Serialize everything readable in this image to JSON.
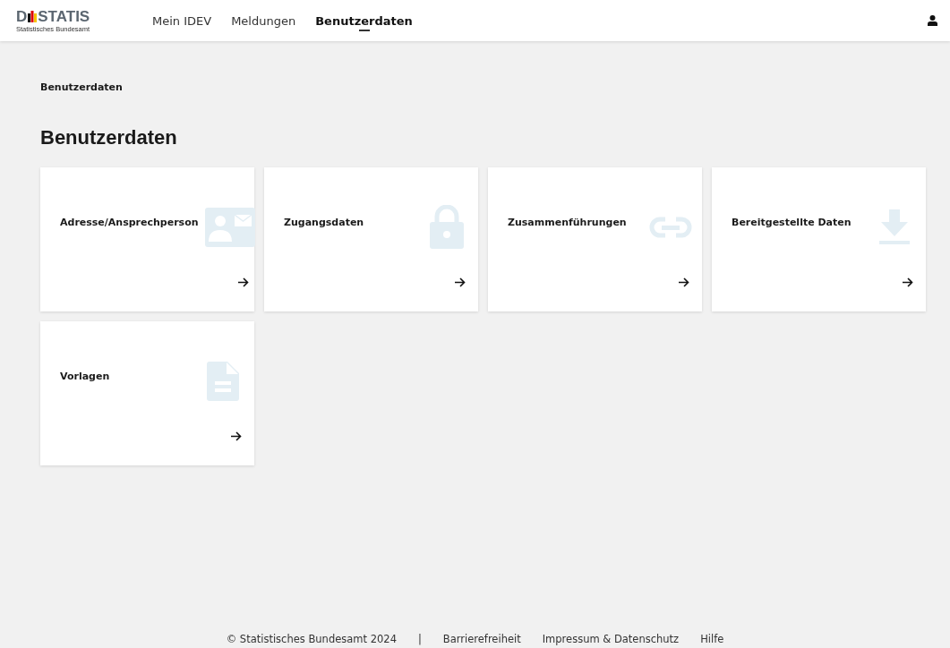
{
  "header": {
    "logo": {
      "text_start": "D",
      "text_end": "STATIS",
      "subtitle": "Statistisches Bundesamt"
    },
    "nav": [
      {
        "label": "Mein IDEV",
        "selected": false
      },
      {
        "label": "Meldungen",
        "selected": false
      },
      {
        "label": "Benutzerdaten",
        "selected": true
      }
    ]
  },
  "breadcrumb": "Benutzerdaten",
  "title": "Benutzerdaten",
  "cards": [
    {
      "label": "Adresse/Ansprechperson",
      "kind": "contact"
    },
    {
      "label": "Zugangsdaten",
      "kind": "lock"
    },
    {
      "label": "Zusammenführungen",
      "kind": "link"
    },
    {
      "label": "Bereitgestellte Daten",
      "kind": "download"
    },
    {
      "label": "Vorlagen",
      "kind": "document"
    }
  ],
  "footer": {
    "copyright": "©  Statistisches Bundesamt 2024",
    "separator": "|",
    "links": [
      "Barrierefreiheit",
      "Impressum & Datenschutz",
      "Hilfe"
    ]
  }
}
